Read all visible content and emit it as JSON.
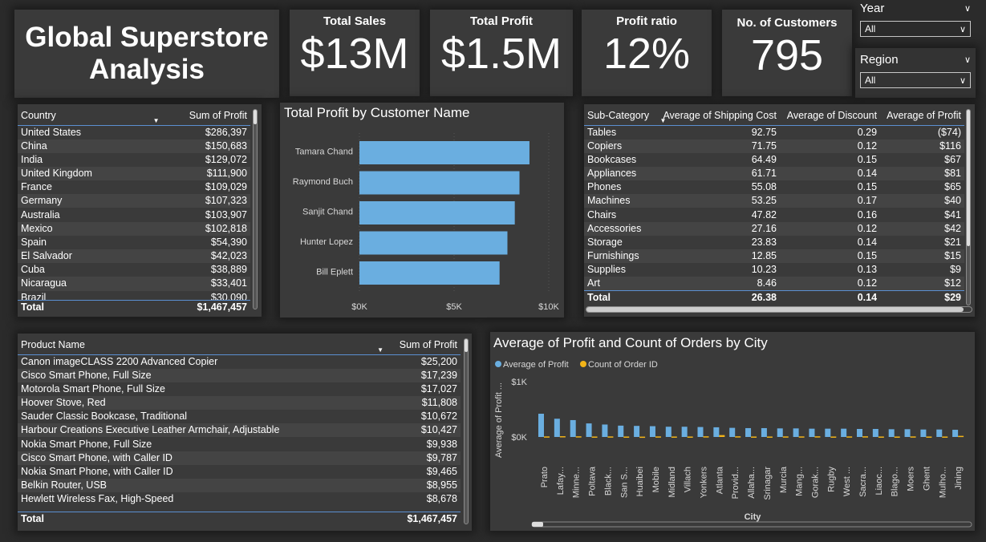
{
  "dashboard": {
    "title_line1": "Global Superstore",
    "title_line2": "Analysis"
  },
  "kpis": [
    {
      "label": "Total Sales",
      "value": "$13M"
    },
    {
      "label": "Total Profit",
      "value": "$1.5M"
    },
    {
      "label": "Profit ratio",
      "value": "12%"
    },
    {
      "label": "No. of Customers",
      "value": "795"
    }
  ],
  "slicers": {
    "year": {
      "label": "Year",
      "value": "All"
    },
    "region": {
      "label": "Region",
      "value": "All"
    }
  },
  "country_table": {
    "headers": [
      "Country",
      "Sum of Profit"
    ],
    "rows": [
      [
        "United States",
        "$286,397"
      ],
      [
        "China",
        "$150,683"
      ],
      [
        "India",
        "$129,072"
      ],
      [
        "United Kingdom",
        "$111,900"
      ],
      [
        "France",
        "$109,029"
      ],
      [
        "Germany",
        "$107,323"
      ],
      [
        "Australia",
        "$103,907"
      ],
      [
        "Mexico",
        "$102,818"
      ],
      [
        "Spain",
        "$54,390"
      ],
      [
        "El Salvador",
        "$42,023"
      ],
      [
        "Cuba",
        "$38,889"
      ],
      [
        "Nicaragua",
        "$33,401"
      ],
      [
        "Brazil",
        "$30,090"
      ]
    ],
    "total": [
      "Total",
      "$1,467,457"
    ]
  },
  "subcat_table": {
    "headers": [
      "Sub-Category",
      "Average of Shipping Cost",
      "Average of Discount",
      "Average of Profit"
    ],
    "rows": [
      [
        "Tables",
        "92.75",
        "0.29",
        "($74)"
      ],
      [
        "Copiers",
        "71.75",
        "0.12",
        "$116"
      ],
      [
        "Bookcases",
        "64.49",
        "0.15",
        "$67"
      ],
      [
        "Appliances",
        "61.71",
        "0.14",
        "$81"
      ],
      [
        "Phones",
        "55.08",
        "0.15",
        "$65"
      ],
      [
        "Machines",
        "53.25",
        "0.17",
        "$40"
      ],
      [
        "Chairs",
        "47.82",
        "0.16",
        "$41"
      ],
      [
        "Accessories",
        "27.16",
        "0.12",
        "$42"
      ],
      [
        "Storage",
        "23.83",
        "0.14",
        "$21"
      ],
      [
        "Furnishings",
        "12.85",
        "0.15",
        "$15"
      ],
      [
        "Supplies",
        "10.23",
        "0.13",
        "$9"
      ],
      [
        "Art",
        "8.46",
        "0.12",
        "$12"
      ]
    ],
    "total": [
      "Total",
      "26.38",
      "0.14",
      "$29"
    ]
  },
  "product_table": {
    "headers": [
      "Product Name",
      "Sum of Profit"
    ],
    "rows": [
      [
        "Canon imageCLASS 2200 Advanced Copier",
        "$25,200"
      ],
      [
        "Cisco Smart Phone, Full Size",
        "$17,239"
      ],
      [
        "Motorola Smart Phone, Full Size",
        "$17,027"
      ],
      [
        "Hoover Stove, Red",
        "$11,808"
      ],
      [
        "Sauder Classic Bookcase, Traditional",
        "$10,672"
      ],
      [
        "Harbour Creations Executive Leather Armchair, Adjustable",
        "$10,427"
      ],
      [
        "Nokia Smart Phone, Full Size",
        "$9,938"
      ],
      [
        "Cisco Smart Phone, with Caller ID",
        "$9,787"
      ],
      [
        "Nokia Smart Phone, with Caller ID",
        "$9,465"
      ],
      [
        "Belkin Router, USB",
        "$8,955"
      ],
      [
        "Hewlett Wireless Fax, High-Speed",
        "$8,678"
      ]
    ],
    "total": [
      "Total",
      "$1,467,457"
    ]
  },
  "chart_data": [
    {
      "type": "bar",
      "orientation": "horizontal",
      "title": "Total Profit by Customer Name",
      "categories": [
        "Tamara Chand",
        "Raymond Buch",
        "Sanjit Chand",
        "Hunter Lopez",
        "Bill Eplett"
      ],
      "values": [
        8981,
        8454,
        8206,
        7817,
        7402
      ],
      "x_ticks": [
        "$0K",
        "$5K",
        "$10K"
      ],
      "xlim": [
        0,
        10000
      ],
      "color": "#6aaee0"
    },
    {
      "type": "bar",
      "title": "Average of Profit and Count of Orders by City",
      "legend": [
        "Average of Profit",
        "Count of Order ID"
      ],
      "legend_placement": "top-left",
      "colors": [
        "#6aaee0",
        "#f2b418"
      ],
      "xlabel": "City",
      "ylabel": "Average of Profit ...",
      "y_ticks": [
        "$1K",
        "$0K"
      ],
      "ylim": [
        0,
        1000
      ],
      "categories": [
        "Prato",
        "Lafay...",
        "Minne...",
        "Poltava",
        "Black...",
        "San S...",
        "Huaibei",
        "Mobile",
        "Midland",
        "Villach",
        "Yonkers",
        "Atlanta",
        "Provid...",
        "Allaha...",
        "Srinagar",
        "Murcia",
        "Mang...",
        "Gorak...",
        "Rugby",
        "West ...",
        "Sacra...",
        "Liaoc...",
        "Blago...",
        "Moers",
        "Ghent",
        "Mulho...",
        "Jining"
      ],
      "series": [
        {
          "name": "Average of Profit",
          "values": [
            420,
            330,
            305,
            245,
            225,
            205,
            200,
            195,
            185,
            185,
            180,
            175,
            165,
            160,
            160,
            155,
            155,
            150,
            150,
            150,
            145,
            145,
            140,
            140,
            135,
            135,
            130
          ]
        },
        {
          "name": "Count of Order ID",
          "values": [
            10,
            14,
            12,
            8,
            10,
            8,
            6,
            10,
            8,
            8,
            12,
            34,
            12,
            8,
            8,
            10,
            10,
            12,
            8,
            10,
            12,
            8,
            8,
            10,
            8,
            8,
            20
          ]
        }
      ]
    }
  ]
}
